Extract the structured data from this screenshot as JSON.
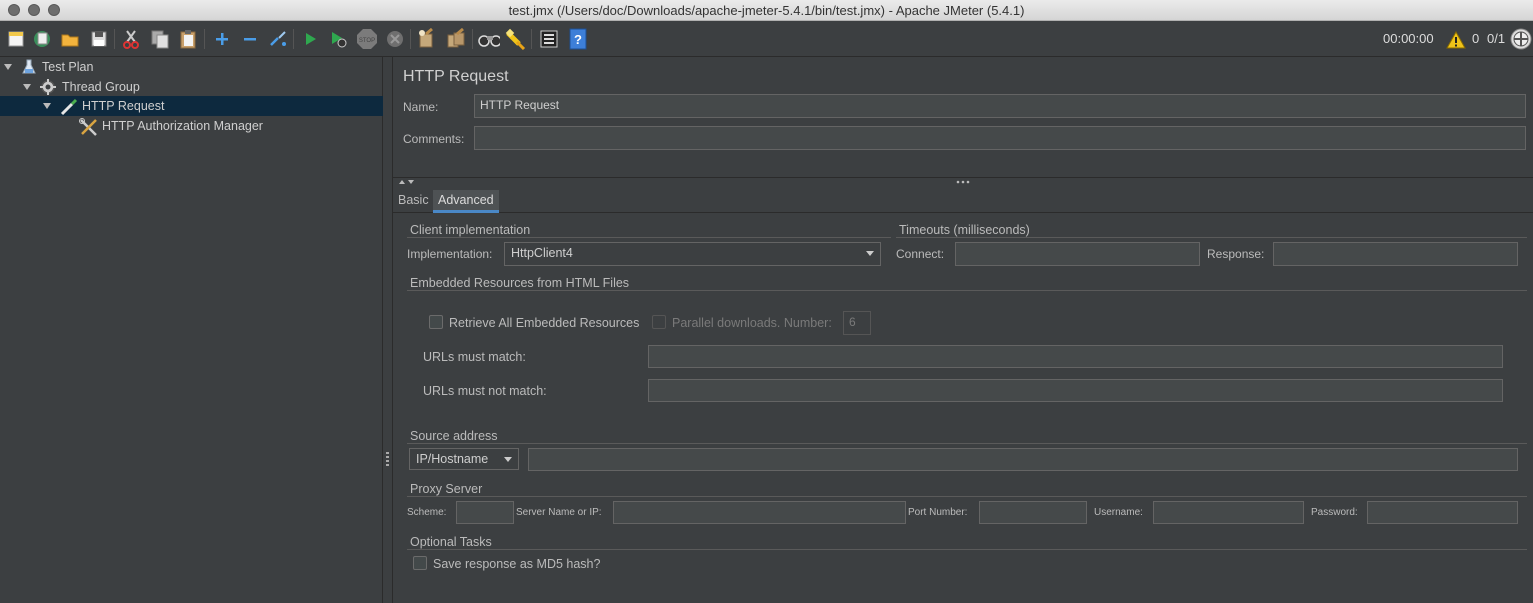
{
  "window": {
    "title": "test.jmx (/Users/doc/Downloads/apache-jmeter-5.4.1/bin/test.jmx) - Apache JMeter (5.4.1)"
  },
  "toolbar": {
    "icons": [
      "new-icon",
      "templates-icon",
      "open-icon",
      "save-icon",
      "cut-icon",
      "copy-icon",
      "paste-icon",
      "expand-icon",
      "collapse-icon",
      "toggle-icon",
      "start-icon",
      "start-no-timers-icon",
      "stop-icon",
      "shutdown-icon",
      "clear-icon",
      "clear-all-icon",
      "search-icon",
      "reset-search-icon",
      "function-helper-icon",
      "help-icon"
    ],
    "elapsed": "00:00:00",
    "warnings": "0",
    "threads": "0/1",
    "colors": {
      "run": "#2fa84f",
      "warn": "#f0c419",
      "help": "#3d7fd8"
    }
  },
  "tree": {
    "items": [
      {
        "label": "Test Plan"
      },
      {
        "label": "Thread Group"
      },
      {
        "label": "HTTP Request"
      },
      {
        "label": "HTTP Authorization Manager"
      }
    ]
  },
  "panel": {
    "title": "HTTP Request",
    "name_label": "Name:",
    "name_value": "HTTP Request",
    "comments_label": "Comments:",
    "comments_value": "",
    "tabs": [
      {
        "label": "Basic"
      },
      {
        "label": "Advanced"
      }
    ],
    "active_tab": "Advanced"
  },
  "advanced": {
    "client_impl": {
      "title": "Client implementation",
      "impl_label": "Implementation:",
      "impl_value": "HttpClient4"
    },
    "timeouts": {
      "title": "Timeouts (milliseconds)",
      "connect_label": "Connect:",
      "connect_value": "",
      "response_label": "Response:",
      "response_value": ""
    },
    "embedded": {
      "title": "Embedded Resources from HTML Files",
      "retrieve_label": "Retrieve All Embedded Resources",
      "parallel_label": "Parallel downloads. Number:",
      "parallel_value": "6",
      "urls_match_label": "URLs must match:",
      "urls_match_value": "",
      "urls_not_match_label": "URLs must not match:",
      "urls_not_match_value": ""
    },
    "source": {
      "title": "Source address",
      "type_value": "IP/Hostname",
      "address_value": ""
    },
    "proxy": {
      "title": "Proxy Server",
      "scheme_label": "Scheme:",
      "server_label": "Server Name or IP:",
      "port_label": "Port Number:",
      "username_label": "Username:",
      "password_label": "Password:"
    },
    "optional": {
      "title": "Optional Tasks",
      "md5_label": "Save response as MD5 hash?"
    }
  }
}
